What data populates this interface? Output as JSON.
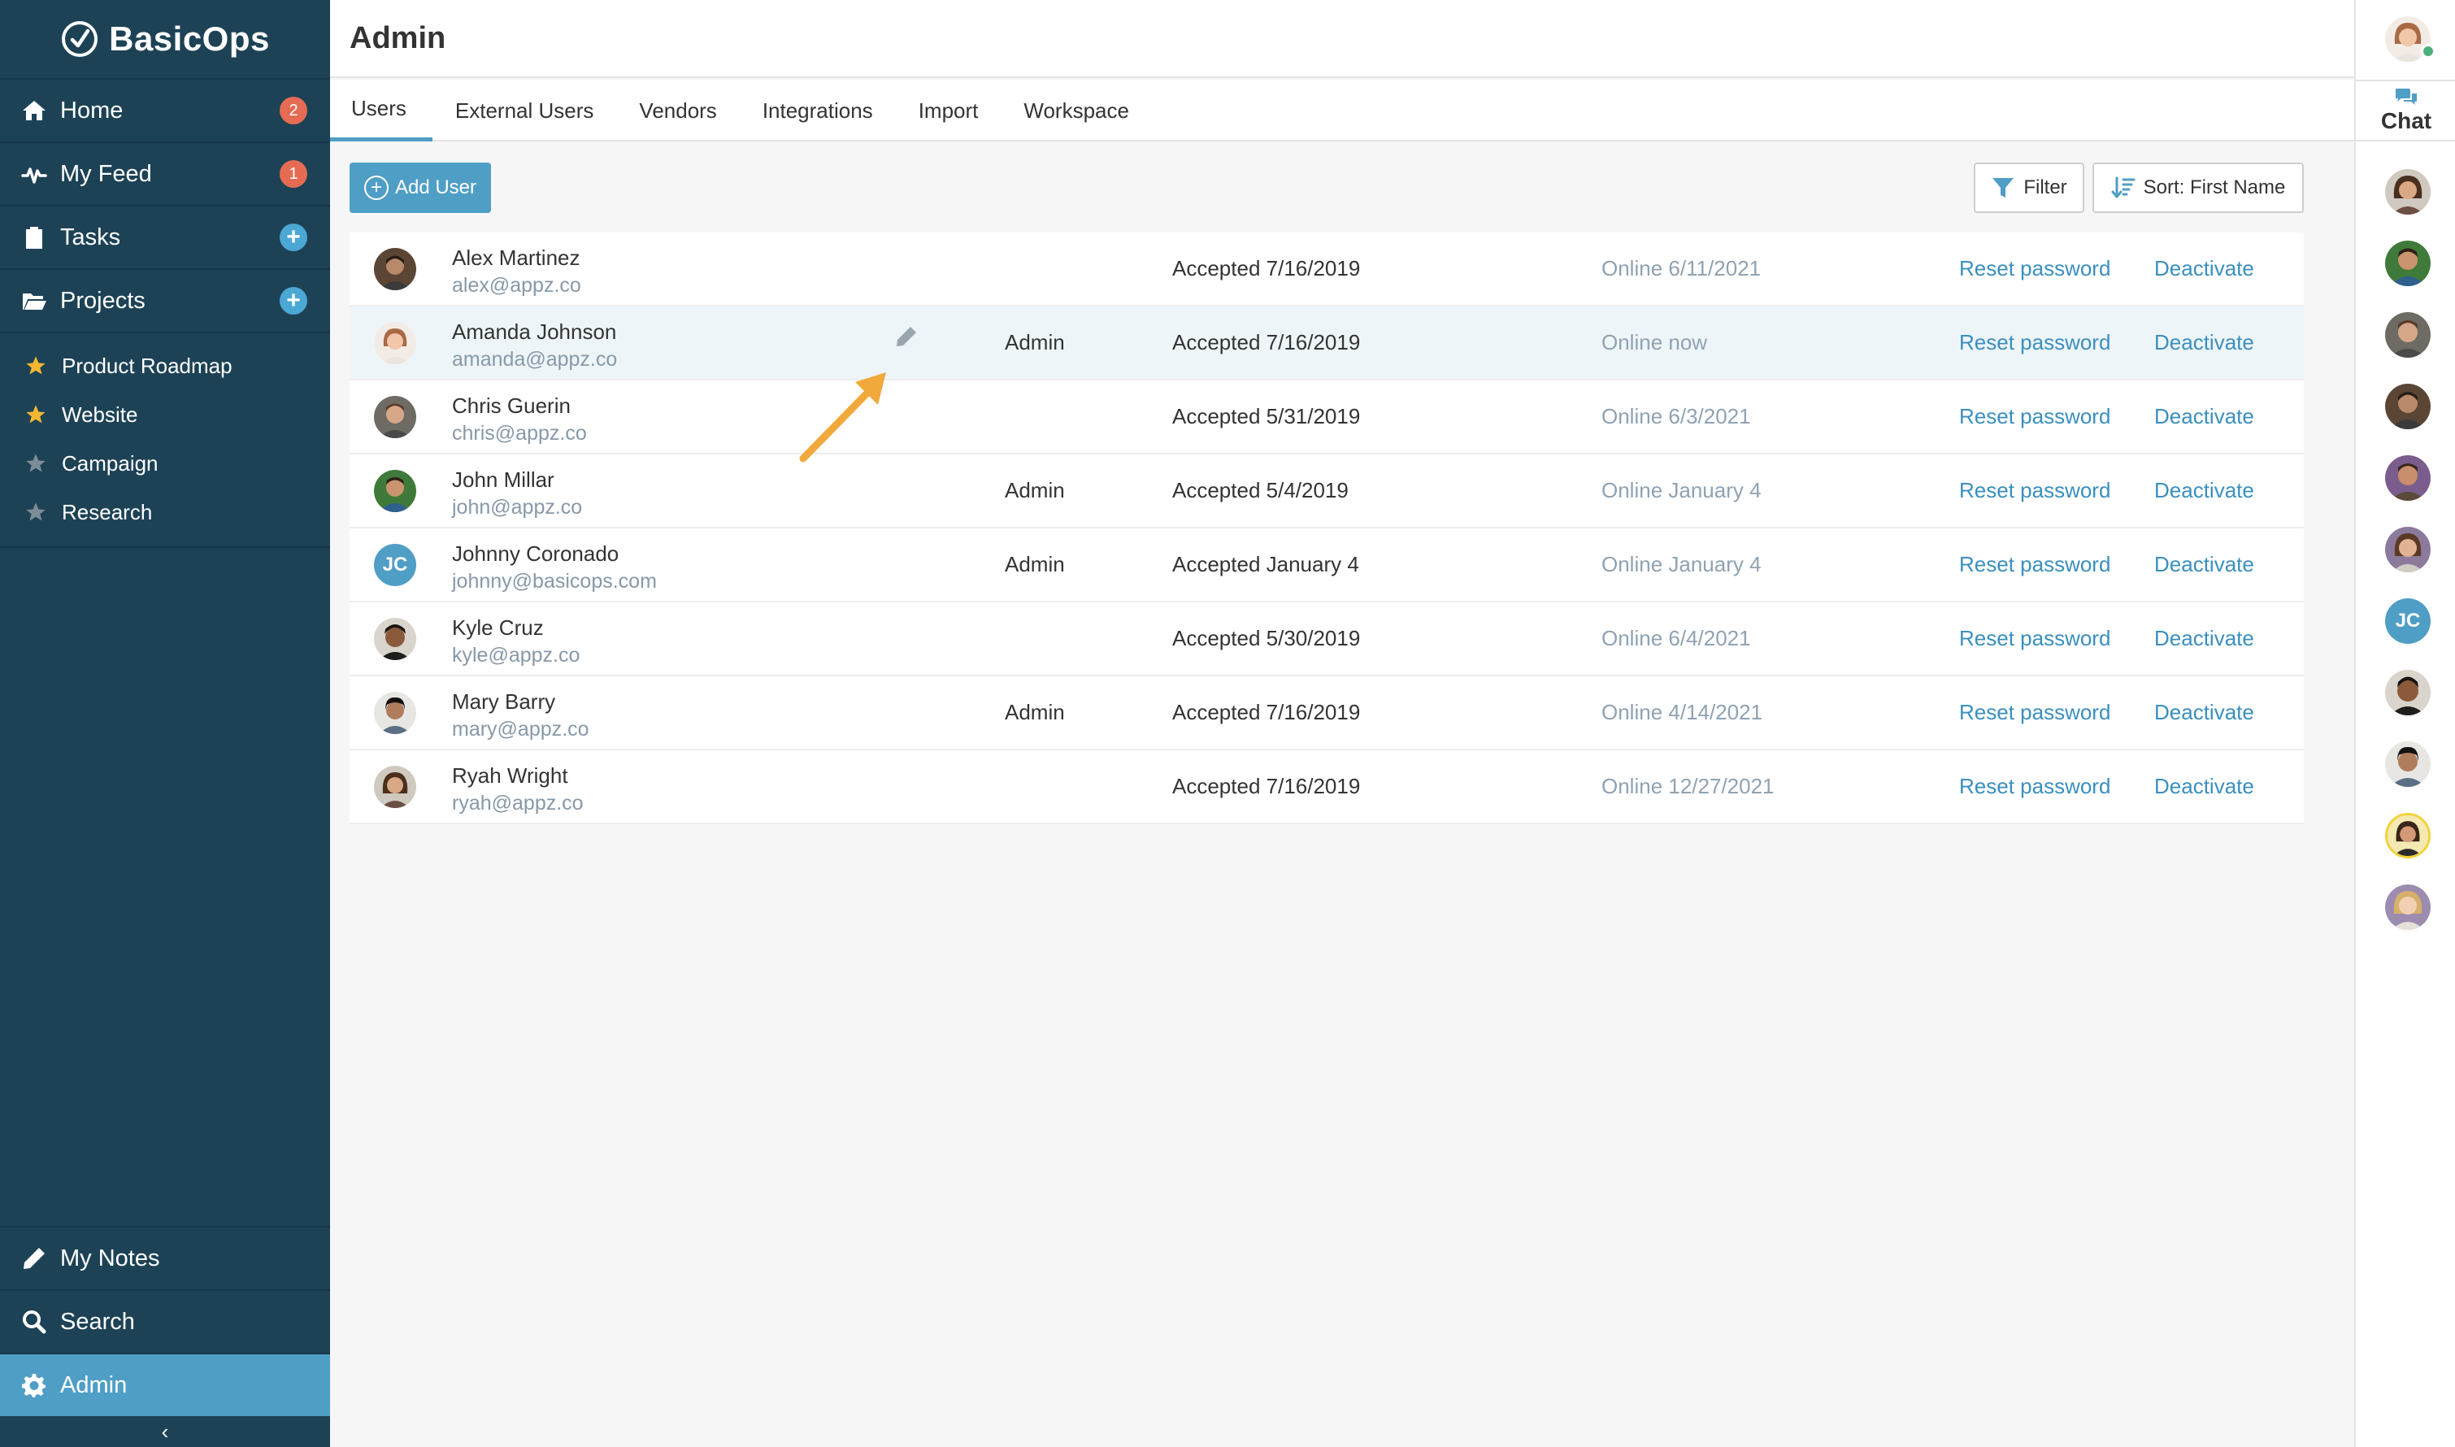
{
  "app": {
    "name": "BasicOps"
  },
  "sidebar": {
    "nav": [
      {
        "label": "Home",
        "badge": "2"
      },
      {
        "label": "My Feed",
        "badge": "1"
      },
      {
        "label": "Tasks"
      },
      {
        "label": "Projects"
      }
    ],
    "projects": [
      {
        "label": "Product Roadmap",
        "starred": true
      },
      {
        "label": "Website",
        "starred": true
      },
      {
        "label": "Campaign",
        "starred": false
      },
      {
        "label": "Research",
        "starred": false
      }
    ],
    "bottom": [
      {
        "label": "My Notes"
      },
      {
        "label": "Search"
      },
      {
        "label": "Admin"
      }
    ],
    "collapse_glyph": "‹"
  },
  "header": {
    "title": "Admin"
  },
  "tabs": [
    "Users",
    "External Users",
    "Vendors",
    "Integrations",
    "Import",
    "Workspace"
  ],
  "toolbar": {
    "add_user": "Add User",
    "filter": "Filter",
    "sort": "Sort: First Name"
  },
  "users": [
    {
      "name": "Alex Martinez",
      "email": "alex@appz.co",
      "role": "",
      "status": "Accepted 7/16/2019",
      "online": "Online 6/11/2021",
      "reset": "Reset password",
      "deactivate": "Deactivate"
    },
    {
      "name": "Amanda Johnson",
      "email": "amanda@appz.co",
      "role": "Admin",
      "status": "Accepted 7/16/2019",
      "online": "Online now",
      "reset": "Reset password",
      "deactivate": "Deactivate"
    },
    {
      "name": "Chris Guerin",
      "email": "chris@appz.co",
      "role": "",
      "status": "Accepted 5/31/2019",
      "online": "Online 6/3/2021",
      "reset": "Reset password",
      "deactivate": "Deactivate"
    },
    {
      "name": "John Millar",
      "email": "john@appz.co",
      "role": "Admin",
      "status": "Accepted 5/4/2019",
      "online": "Online January 4",
      "reset": "Reset password",
      "deactivate": "Deactivate"
    },
    {
      "name": "Johnny Coronado",
      "email": "johnny@basicops.com",
      "initials": "JC",
      "role": "Admin",
      "status": "Accepted January 4",
      "online": "Online January 4",
      "reset": "Reset password",
      "deactivate": "Deactivate"
    },
    {
      "name": "Kyle Cruz",
      "email": "kyle@appz.co",
      "role": "",
      "status": "Accepted 5/30/2019",
      "online": "Online 6/4/2021",
      "reset": "Reset password",
      "deactivate": "Deactivate"
    },
    {
      "name": "Mary Barry",
      "email": "mary@appz.co",
      "role": "Admin",
      "status": "Accepted 7/16/2019",
      "online": "Online 4/14/2021",
      "reset": "Reset password",
      "deactivate": "Deactivate"
    },
    {
      "name": "Ryah Wright",
      "email": "ryah@appz.co",
      "role": "",
      "status": "Accepted 7/16/2019",
      "online": "Online 12/27/2021",
      "reset": "Reset password",
      "deactivate": "Deactivate"
    }
  ],
  "chat": {
    "label": "Chat",
    "contact_initials": "JC"
  },
  "colors": {
    "sidebar_bg": "#1d4256",
    "accent": "#4f9ec6",
    "badge": "#e56c53",
    "link": "#3a8fbf",
    "arrow": "#f2a93b"
  },
  "icons": {
    "logo": "check-circle-icon",
    "home": "home-icon",
    "feed": "pulse-icon",
    "tasks": "clipboard-icon",
    "projects": "folder-open-icon",
    "notes": "pencil-icon",
    "search": "search-icon",
    "admin": "gear-icon",
    "filter": "funnel-icon",
    "sort": "sort-icon",
    "edit": "pencil-icon",
    "chat": "chat-bubbles-icon"
  }
}
